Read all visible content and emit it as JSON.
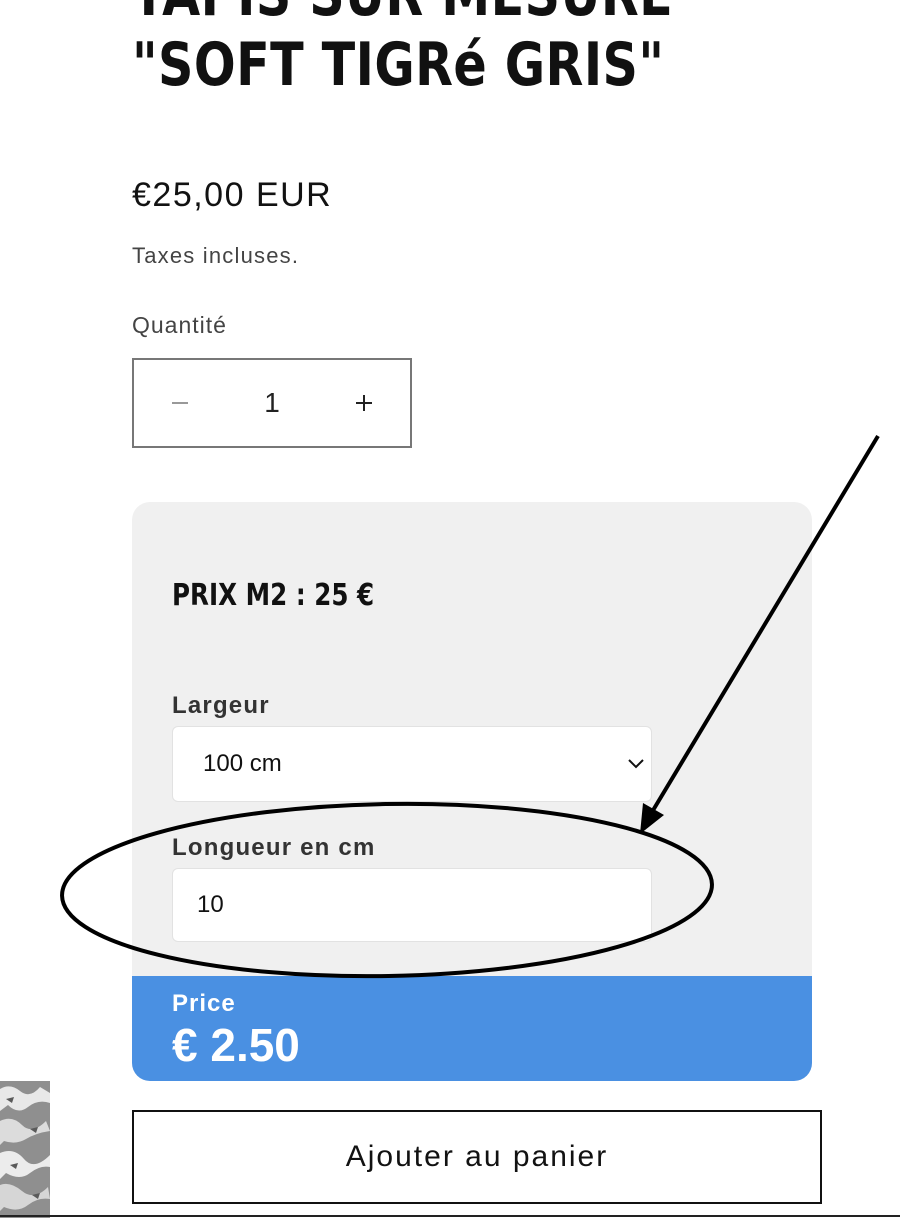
{
  "product": {
    "title_line1": "TAPIS SUR MESURE",
    "title_line2": "\"SOFT TIGRé GRIS\"",
    "price": "€25,00 EUR",
    "tax_note": "Taxes incluses."
  },
  "quantity": {
    "label": "Quantité",
    "value": "1",
    "minus_icon": "minus-icon",
    "plus_icon": "plus-icon"
  },
  "calculator": {
    "heading": "PRIX M2 : 25 €",
    "width_label": "Largeur",
    "width_selected": "100 cm",
    "length_label": "Longueur en cm",
    "length_value": "10",
    "price_label": "Price",
    "price_value": "€ 2.50",
    "accent_color": "#4a90e2",
    "panel_color": "#f0f0f0"
  },
  "actions": {
    "add_to_cart": "Ajouter au panier"
  },
  "annotation": {
    "shapes": [
      "ellipse",
      "arrow"
    ],
    "color": "#000000"
  }
}
